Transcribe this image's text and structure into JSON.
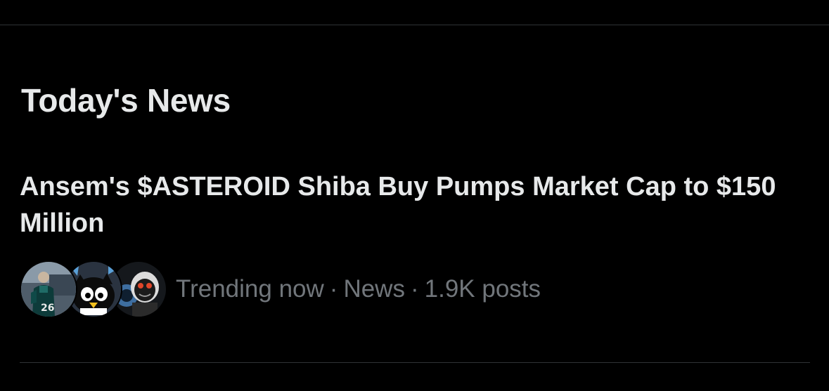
{
  "section": {
    "title": "Today's News"
  },
  "news_item": {
    "headline": "Ansem's $ASTEROID Shiba Buy Pumps Market Cap to $150 Million",
    "meta": {
      "status": "Trending now",
      "category": "News",
      "posts": "1.9K posts",
      "separator": "·"
    },
    "avatars": [
      {
        "name": "avatar-jersey",
        "jersey_number": "26"
      },
      {
        "name": "avatar-cartoon-penguin"
      },
      {
        "name": "avatar-dark-figure"
      }
    ]
  },
  "colors": {
    "background": "#000000",
    "primary_text": "#e7e9ea",
    "secondary_text": "#71767b",
    "divider": "#2f3336"
  }
}
